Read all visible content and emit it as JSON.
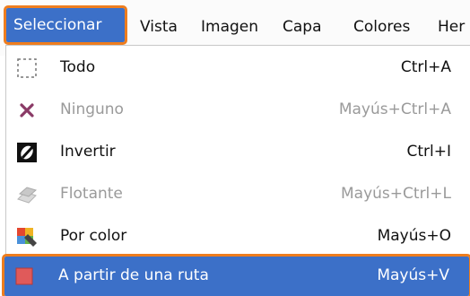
{
  "menubar": {
    "items": [
      {
        "label": "Seleccionar",
        "active": true
      },
      {
        "label": "Vista"
      },
      {
        "label": "Imagen"
      },
      {
        "label": "Capa"
      },
      {
        "label": "Colores"
      },
      {
        "label": "Her"
      }
    ]
  },
  "menu": {
    "items": [
      {
        "label": "Todo",
        "shortcut": "Ctrl+A",
        "icon": "select-all-icon",
        "enabled": true
      },
      {
        "label": "Ninguno",
        "shortcut": "Mayús+Ctrl+A",
        "icon": "select-none-icon",
        "enabled": false
      },
      {
        "label": "Invertir",
        "shortcut": "Ctrl+I",
        "icon": "invert-selection-icon",
        "enabled": true
      },
      {
        "label": "Flotante",
        "shortcut": "Mayús+Ctrl+L",
        "icon": "float-selection-icon",
        "enabled": false
      },
      {
        "label": "Por color",
        "shortcut": "Mayús+O",
        "icon": "select-by-color-icon",
        "enabled": true
      },
      {
        "label": "A partir de una ruta",
        "shortcut": "Mayús+V",
        "icon": "selection-from-path-icon",
        "enabled": true,
        "highlighted": true
      }
    ]
  },
  "colors": {
    "highlight": "#3c70c8",
    "callout": "#ee7d1e",
    "disabled_text": "#9a9a9a"
  }
}
